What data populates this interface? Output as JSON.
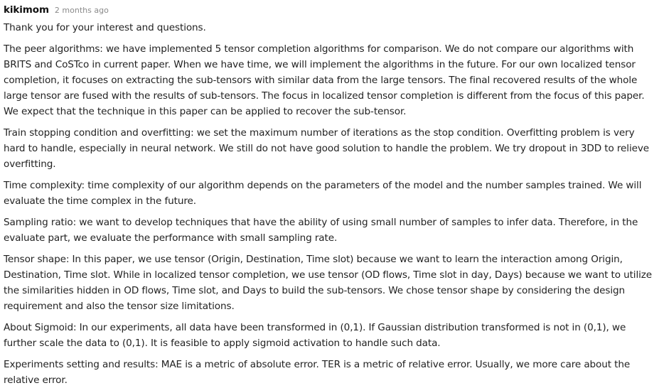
{
  "comment": {
    "author": "kikimom",
    "timestamp": "2 months ago",
    "paragraphs": [
      "Thank you for your interest and questions.",
      "The peer algorithms: we have implemented 5 tensor completion algorithms for comparison. We do not compare our algorithms with BRITS and CoSTco in current paper. When we have time, we will implement the algorithms in the future. For our own localized tensor completion, it focuses on extracting the sub-tensors with similar data from the large tensors. The final recovered results of the whole large tensor are fused with the results of sub-tensors. The focus in localized tensor completion is different from the focus of this paper. We expect that the technique in this paper can be applied to recover the sub-tensor.",
      "Train stopping condition and overfitting: we set the maximum number of iterations as the stop condition. Overfitting problem is very hard to handle, especially in neural network. We still do not have good solution to handle the problem. We try dropout in 3DD to relieve overfitting.",
      "Time complexity: time complexity of our algorithm depends on the parameters of the model and the number samples trained. We will evaluate the time complex in the future.",
      "Sampling ratio: we want to develop techniques that have the ability of using small number of samples to infer data. Therefore, in the evaluate part, we evaluate the performance with small sampling rate.",
      "Tensor shape: In this paper, we use tensor (Origin, Destination, Time slot) because we want to learn the interaction among Origin, Destination, Time slot. While in localized tensor completion, we use tensor (OD flows, Time slot in day, Days) because we want to utilize the similarities hidden in OD flows, Time slot, and Days to build the sub-tensors. We chose tensor shape by considering the design requirement and also the tensor size limitations.",
      "About Sigmoid: In our experiments, all data have been transformed in (0,1). If Gaussian distribution transformed is not in (0,1), we further scale the data to (0,1).  It is feasible to apply sigmoid activation to handle such data.",
      "Experiments setting and results: MAE is a metric of absolute error. TER is a metric of relative error. Usually, we more care about the relative error."
    ]
  }
}
